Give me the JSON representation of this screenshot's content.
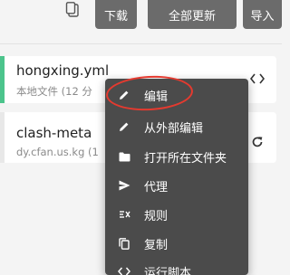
{
  "toolbar": {
    "paste_icon": "clipboard-icon",
    "download_label": "下载",
    "update_all_label": "全部更新",
    "import_label": "导入"
  },
  "profiles": [
    {
      "name": "hongxing.yml",
      "subtitle": "本地文件 (12 分",
      "action_icon": "code-icon",
      "selected": true,
      "accent": "#4cc48c"
    },
    {
      "name": "clash-meta",
      "subtitle": "dy.cfan.us.kg (1",
      "action_icon": "refresh-icon",
      "selected": false
    }
  ],
  "context_menu": {
    "items": [
      {
        "label": "编辑",
        "icon": "pencil-icon"
      },
      {
        "label": "从外部编辑",
        "icon": "pencil-icon"
      },
      {
        "label": "打开所在文件夹",
        "icon": "folder-icon"
      },
      {
        "label": "代理",
        "icon": "send-icon"
      },
      {
        "label": "规则",
        "icon": "rules-icon"
      },
      {
        "label": "复制",
        "icon": "copy-icon"
      },
      {
        "label": "运行脚本",
        "icon": "code-icon"
      }
    ]
  },
  "colors": {
    "accent_green": "#4cc48c",
    "menu_bg": "#4b4b4b",
    "annotation_red": "#e53a2f",
    "toolbar_button": "#6b6b6b"
  }
}
